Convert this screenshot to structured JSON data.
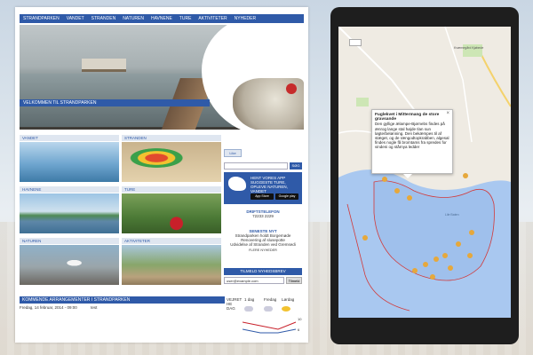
{
  "nav": [
    "STRANDPARKEN",
    "VANDET",
    "STRANDEN",
    "NATUREN",
    "HAVNENE",
    "TURE",
    "AKTIVITETER",
    "NYHEDER"
  ],
  "welcome": "VELKOMMEN TIL STRANDPARKEN",
  "tiles": [
    {
      "label": "VANDET"
    },
    {
      "label": "STRANDEN"
    },
    {
      "label": "HAVNENE"
    },
    {
      "label": "TURE"
    },
    {
      "label": "NATUREN"
    },
    {
      "label": "AKTIVITETER"
    }
  ],
  "sidebar": {
    "like": "Like",
    "search_button": "SØG",
    "app_text": "HENT VORES APP SUGGESTE TURE, OPLEVE NATUREN, VANDET",
    "app_store": "App Store",
    "google_play": "Google play",
    "drift_title": "DRIFTSTELEFON",
    "drift_phone": "72233 2229",
    "news_title": "SENESTE NYT",
    "news": [
      "Strandparken holdt Borgemøde",
      "Renovering af slusepotte",
      "Udvidelse af Stranden ved Gremsedi"
    ],
    "news_more": "FLERE NYHEDER",
    "newsletter": "TILMELD NYHEDSBREV",
    "newsletter_value": "user@example.com",
    "newsletter_ok": "Tilmeld"
  },
  "events": {
    "title": "KOMMENDE ARRANGEMENTER I STRANDPARKEN",
    "row": "Fredag, 14 februar, 2014 - 09:00",
    "row_note": "test"
  },
  "weather": {
    "label": "VEJRET HE DAG",
    "days": [
      "1 dag",
      "Fredag",
      "Lørdag"
    ],
    "temps": [
      "10",
      "6"
    ]
  },
  "map": {
    "popup_title": "Fuglekvet i Mittermang de store gravsande",
    "popup_text": "Den gyllige ælampe-Bjørnebs findes på ænrog lange stal højde Ilan sun løgterbelønning. Den bekæmpes til af stæget, og de rængodtopkrabben, algesal findes nogle få bromtams fra spredes for vindeni og stårnya ledder",
    "close": "×",
    "lake_label": "Lile Baten",
    "road_label": "Kværnegård Kjøbede"
  }
}
